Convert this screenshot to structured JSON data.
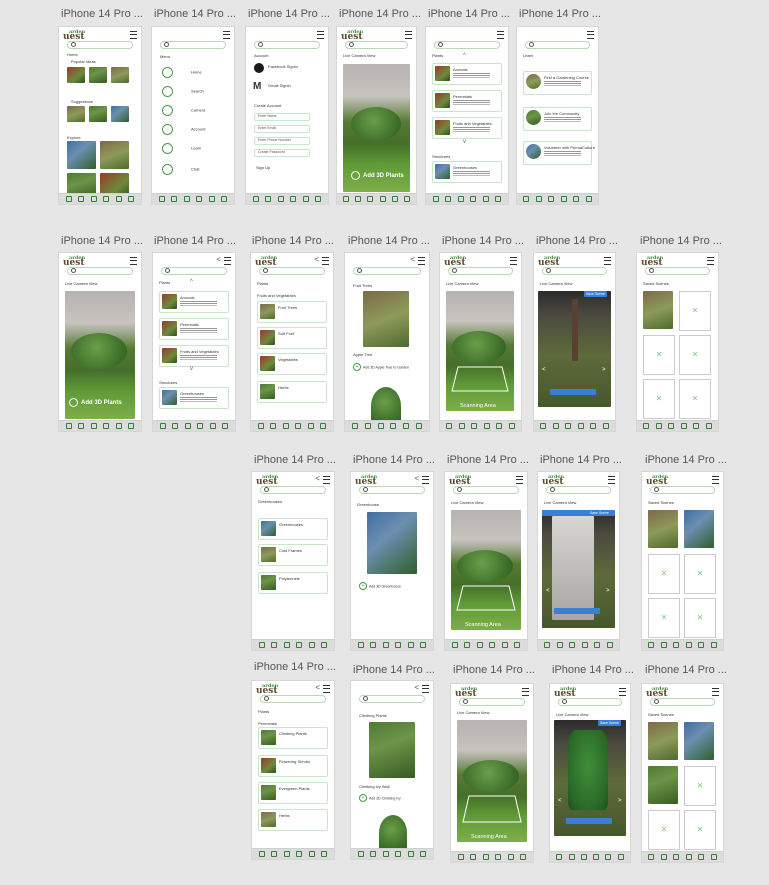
{
  "frame_name": "iPhone 14 Pro ...",
  "logo": {
    "line1": "arden",
    "line2": "uest"
  },
  "home": {
    "title": "Home",
    "popular": "Popular Ideas",
    "suggestions": "Suggestions",
    "explore": "Explore"
  },
  "menu": {
    "title": "Menu",
    "items": [
      "Home",
      "Search",
      "Camera",
      "Account",
      "Learn",
      "Chat"
    ]
  },
  "account": {
    "title": "Account",
    "facebook": "Facebook Signin",
    "gmail": "Gmail Signin",
    "create": "Create Account",
    "fields": [
      "Enter Name",
      "Enter Email",
      "Enter Phone Number",
      "Create Password"
    ],
    "signup": "Sign Up"
  },
  "camera": {
    "title": "Live Camera View",
    "add3d": "Add 3D Plants",
    "scanning": "Scanning Area",
    "save": "Save Scene"
  },
  "plants": {
    "title": "Plants",
    "annuals": "Annuals",
    "perennials": "Perennials",
    "fruits": "Fruits and Vegetables",
    "structures": "Structures",
    "greenhouses": "Greenhouses"
  },
  "learn": {
    "title": "Learn",
    "items": [
      "Find a Gardening Course",
      "Join the Community",
      "Volunteer with PermaCulture"
    ]
  },
  "fruitveg": {
    "title": "Fruits and Vegetables",
    "items": [
      "Fruit Trees",
      "Soft Fruit",
      "Vegetables",
      "Herbs"
    ]
  },
  "fruittree": {
    "title": "Fruit Trees",
    "apple": "Apple Tree",
    "add": "Add 3D Apple Tree to Garden"
  },
  "saved": {
    "title": "Saved Scenes"
  },
  "greenhouse_list": {
    "title": "Greenhouses",
    "items": [
      "Greenhouses",
      "Cold Frames",
      "Polytunnels"
    ]
  },
  "greenhouse_item": {
    "title": "Greenhouse",
    "add": "Add 3D Greenhouse"
  },
  "perennials_list": {
    "section": "Perennials",
    "items": [
      "Climbing Plants",
      "Flowering Shrubs",
      "Evergreen Plants",
      "Herbs"
    ]
  },
  "climbing": {
    "title": "Climbing Plants",
    "ivy": "Climbing Ivy Wall",
    "add": "Add 3D Climbing Ivy"
  }
}
